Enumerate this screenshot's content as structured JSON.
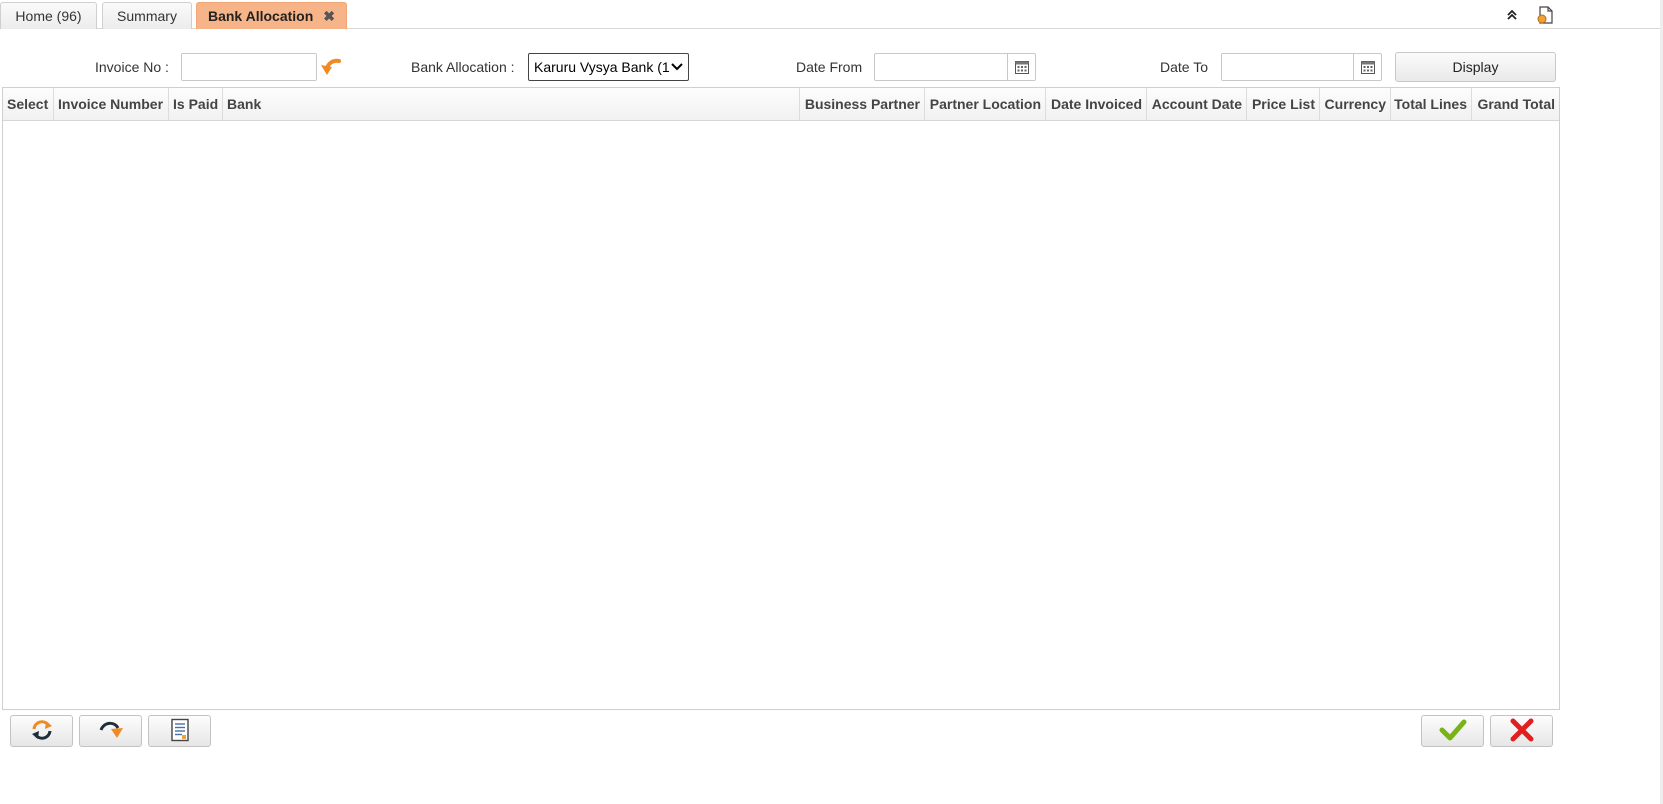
{
  "tabs": [
    {
      "label": "Home (96)"
    },
    {
      "label": "Summary"
    },
    {
      "label": "Bank Allocation",
      "close": "✖"
    }
  ],
  "filters": {
    "invoice_no_label": "Invoice No :",
    "invoice_no_value": "",
    "bank_allocation_label": "Bank Allocation :",
    "bank_allocation_value": "Karuru Vysya Bank (1",
    "date_from_label": "Date From",
    "date_from_value": "",
    "date_to_label": "Date To",
    "date_to_value": "",
    "display_label": "Display"
  },
  "grid": {
    "columns": [
      "Select",
      "Invoice Number",
      "Is Paid",
      "Bank",
      "Business Partner",
      "Partner Location",
      "Date Invoiced",
      "Account Date",
      "Price List",
      "Currency",
      "Total Lines",
      "Grand Total"
    ],
    "rows": []
  },
  "colors": {
    "active_tab": "#f7b488",
    "arrow_orange": "#f08a24",
    "ok_green": "#7ab317",
    "cancel_red": "#e02020"
  },
  "icons": {
    "collapse": "double-chevron-up-icon",
    "export": "document-export-icon",
    "lookup": "curved-arrow-icon",
    "calendar": "calendar-icon",
    "refresh": "refresh-icon",
    "redo": "redo-arrow-icon",
    "report": "report-document-icon",
    "ok": "checkmark-icon",
    "cancel": "cross-icon"
  }
}
